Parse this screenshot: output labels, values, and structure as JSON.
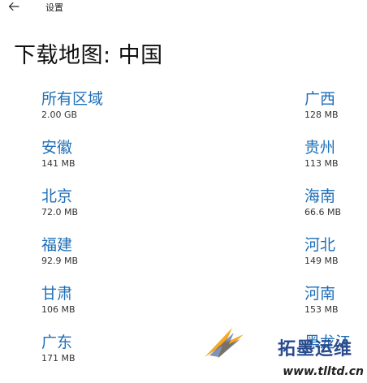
{
  "titlebar": {
    "back_icon": "back-arrow-icon",
    "title": "设置"
  },
  "page": {
    "title": "下载地图: 中国"
  },
  "regions_left": [
    {
      "name": "所有区域",
      "size": "2.00 GB"
    },
    {
      "name": "安徽",
      "size": "141 MB"
    },
    {
      "name": "北京",
      "size": "72.0 MB"
    },
    {
      "name": "福建",
      "size": "92.9 MB"
    },
    {
      "name": "甘肃",
      "size": "106 MB"
    },
    {
      "name": "广东",
      "size": "171 MB"
    }
  ],
  "regions_right": [
    {
      "name": "广西",
      "size": "128 MB"
    },
    {
      "name": "贵州",
      "size": "113 MB"
    },
    {
      "name": "海南",
      "size": "66.6 MB"
    },
    {
      "name": "河北",
      "size": "149 MB"
    },
    {
      "name": "河南",
      "size": "153 MB"
    },
    {
      "name": "黑龙江",
      "size": ""
    }
  ],
  "watermark": {
    "text_cn": "拓墨运维",
    "url": "www.tlltd.cn"
  },
  "colors": {
    "link": "#1e6fb8",
    "text": "#1a1a1a",
    "background": "#ffffff",
    "watermark_blue": "#2a4b8d",
    "watermark_orange": "#f39800"
  }
}
